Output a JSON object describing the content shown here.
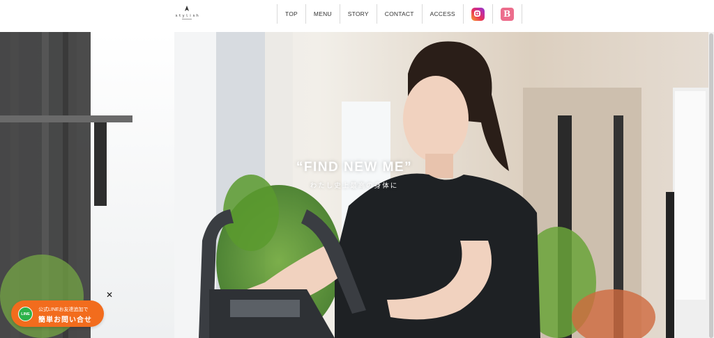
{
  "header": {
    "nav": [
      {
        "label": "TOP"
      },
      {
        "label": "MENU"
      },
      {
        "label": "STORY"
      },
      {
        "label": "CONTACT"
      },
      {
        "label": "ACCESS"
      }
    ],
    "social": [
      {
        "icon": "instagram-icon"
      },
      {
        "icon": "beauty-b-icon",
        "glyph": "B"
      }
    ]
  },
  "hero": {
    "title": "“FIND NEW ME”",
    "subtitle": "わたし史上最高の身体に"
  },
  "line_widget": {
    "close": "✕",
    "logo_text": "LINE",
    "line1": "公式LINEお友達追加で",
    "line2": "簡単お問い合せ",
    "color": "#f26c1d"
  },
  "colors": {
    "instagram": "#e8315a",
    "beauty": "#ec6d8c",
    "line_green": "#2db24a"
  }
}
